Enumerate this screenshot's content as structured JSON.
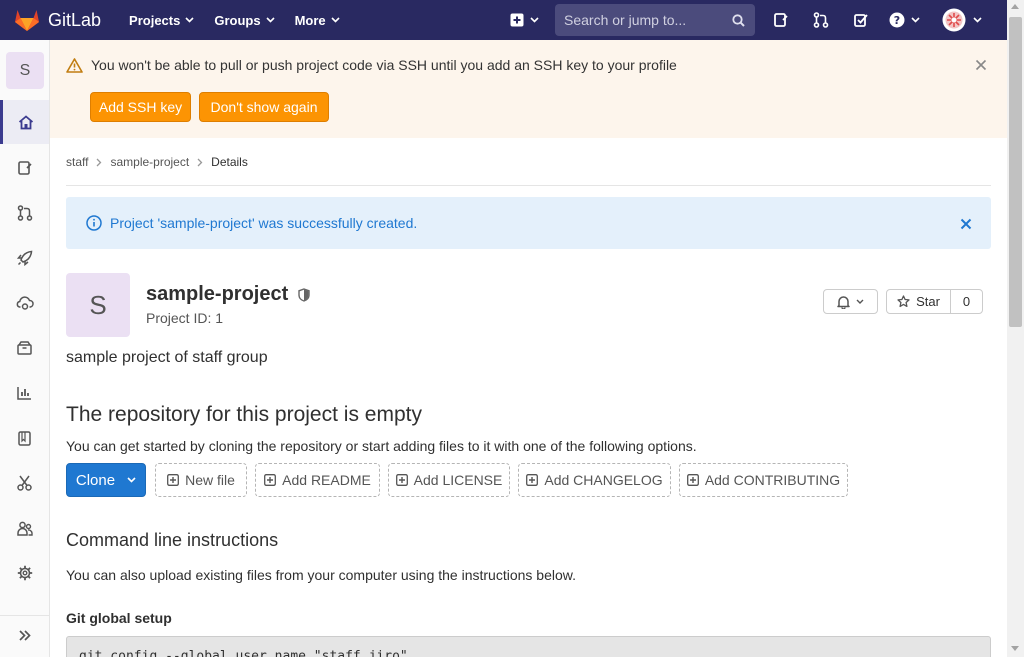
{
  "topbar": {
    "brand": "GitLab",
    "menu": [
      {
        "label": "Projects"
      },
      {
        "label": "Groups"
      },
      {
        "label": "More"
      }
    ],
    "search_placeholder": "Search or jump to..."
  },
  "sidebar": {
    "project_letter": "S"
  },
  "ssh_banner": {
    "message": "You won't be able to pull or push project code via SSH until you add an SSH key to your profile",
    "add_key_label": "Add SSH key",
    "dont_show_label": "Don't show again"
  },
  "breadcrumb": {
    "items": [
      "staff",
      "sample-project"
    ],
    "current": "Details"
  },
  "flash": {
    "message": "Project 'sample-project' was successfully created."
  },
  "project": {
    "letter": "S",
    "name": "sample-project",
    "id_label": "Project ID: 1",
    "description": "sample project of staff group",
    "star_label": "Star",
    "star_count": "0"
  },
  "empty_repo": {
    "title": "The repository for this project is empty",
    "subtitle": "You can get started by cloning the repository or start adding files to it with one of the following options.",
    "clone_label": "Clone",
    "actions": [
      "New file",
      "Add README",
      "Add LICENSE",
      "Add CHANGELOG",
      "Add CONTRIBUTING"
    ]
  },
  "cli": {
    "title": "Command line instructions",
    "subtitle": "You can also upload existing files from your computer using the instructions below.",
    "git_setup_title": "Git global setup",
    "code_line": "git config --global user.name \"staff jiro\""
  },
  "colors": {
    "navbar": "#292961",
    "accent_blue": "#1f78d1",
    "warning_orange": "#fc9403",
    "banner_bg": "#fdf5ec",
    "flash_bg": "#e4f0fb"
  }
}
